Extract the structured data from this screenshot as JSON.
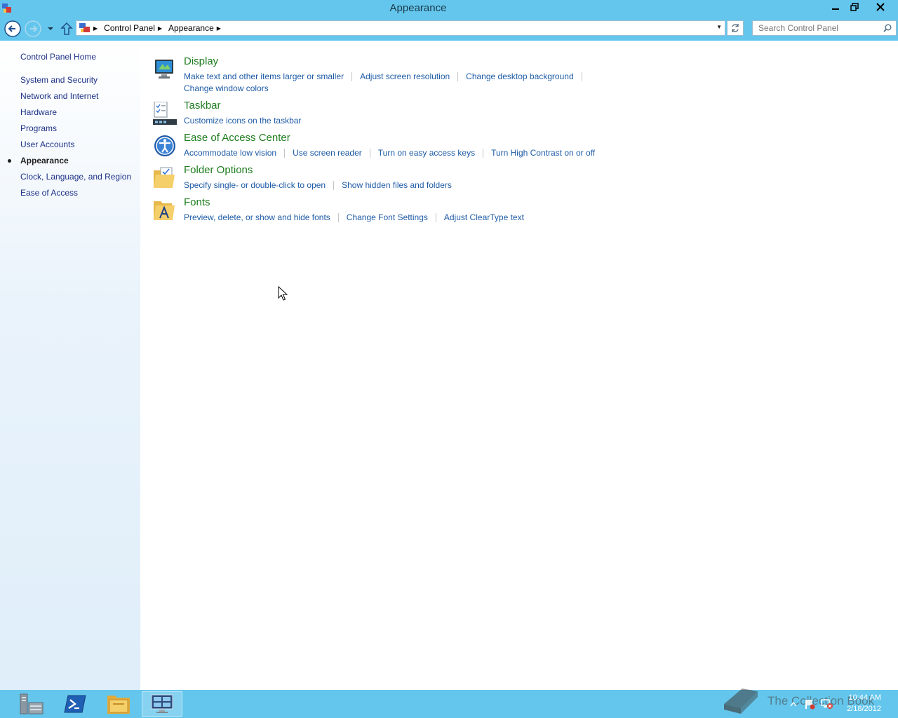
{
  "window": {
    "title": "Appearance",
    "minimize_icon": "minimize-icon",
    "maximize_icon": "restore-icon",
    "close_icon": "close-icon"
  },
  "navbar": {
    "breadcrumbs": [
      "Control Panel",
      "Appearance"
    ],
    "search_placeholder": "Search Control Panel"
  },
  "sidebar": {
    "home": "Control Panel Home",
    "items": [
      {
        "label": "System and Security"
      },
      {
        "label": "Network and Internet"
      },
      {
        "label": "Hardware"
      },
      {
        "label": "Programs"
      },
      {
        "label": "User Accounts"
      },
      {
        "label": "Appearance",
        "current": true
      },
      {
        "label": "Clock, Language, and Region"
      },
      {
        "label": "Ease of Access"
      }
    ]
  },
  "categories": [
    {
      "title": "Display",
      "icon": "display-monitor-icon",
      "links": [
        "Make text and other items larger or smaller",
        "Adjust screen resolution",
        "Change desktop background",
        "Change window colors"
      ]
    },
    {
      "title": "Taskbar",
      "icon": "taskbar-icon",
      "links": [
        "Customize icons on the taskbar"
      ]
    },
    {
      "title": "Ease of Access Center",
      "icon": "ease-of-access-icon",
      "links": [
        "Accommodate low vision",
        "Use screen reader",
        "Turn on easy access keys",
        "Turn High Contrast on or off"
      ]
    },
    {
      "title": "Folder Options",
      "icon": "folder-options-icon",
      "links": [
        "Specify single- or double-click to open",
        "Show hidden files and folders"
      ]
    },
    {
      "title": "Fonts",
      "icon": "fonts-folder-icon",
      "links": [
        "Preview, delete, or show and hide fonts",
        "Change Font Settings",
        "Adjust ClearType text"
      ]
    }
  ],
  "taskbar": {
    "watermark": "The Collection Book",
    "time": "10:44 AM",
    "date": "2/18/2012"
  },
  "colors": {
    "chrome": "#64c6ec",
    "category_title": "#1e7c1e",
    "link": "#1e5ba6",
    "nav_link": "#1e3287"
  }
}
